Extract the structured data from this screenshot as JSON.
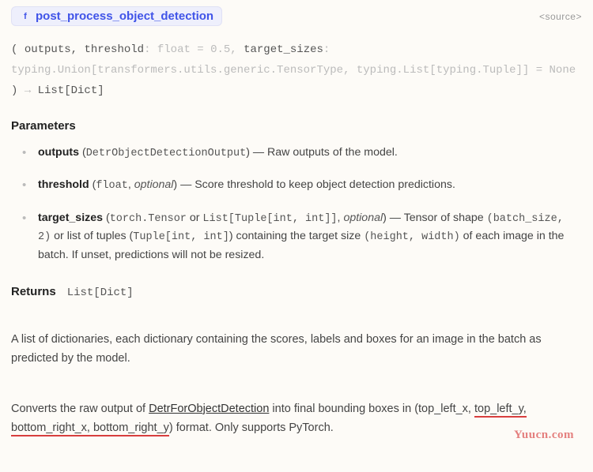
{
  "header": {
    "fn_icon_glyph": "f",
    "fn_name": "post_process_object_detection",
    "source_label": "<source>"
  },
  "signature": {
    "open": "( ",
    "p1": "outputs",
    "sep1": ", ",
    "p2": "threshold",
    "p2_type": ": float = 0.5, ",
    "p3": "target_sizes",
    "p3_type": ": typing.Union[transformers.utils.generic.TensorType, typing.List[typing.Tuple]] = None ",
    "close": ") ",
    "arrow": "→ ",
    "ret": "List[Dict]"
  },
  "params_title": "Parameters",
  "params": [
    {
      "name": "outputs",
      "type_open": " (",
      "type_code": "DetrObjectDetectionOutput",
      "type_close": ") — ",
      "desc": "Raw outputs of the model."
    },
    {
      "name": "threshold",
      "type_open": " (",
      "type_code": "float",
      "optional_sep": ", ",
      "optional": "optional",
      "type_close": ") — ",
      "desc": "Score threshold to keep object detection predictions."
    },
    {
      "name": "target_sizes",
      "type_open": " (",
      "type_code": "torch.Tensor",
      "or_text": " or ",
      "type_code2": "List[Tuple[int, int]]",
      "optional_sep": ", ",
      "optional": "optional",
      "type_close": ") — ",
      "desc_a": "Tensor of shape ",
      "code_a": "(batch_size, 2)",
      "desc_b": " or list of tuples (",
      "code_b": "Tuple[int, int]",
      "desc_c": ") containing the target size ",
      "code_c": "(height, width)",
      "desc_d": " of each image in the batch. If unset, predictions will not be resized."
    }
  ],
  "returns_label": "Returns",
  "returns_type": "List[Dict]",
  "body1": "A list of dictionaries, each dictionary containing the scores, labels and boxes for an image in the batch as predicted by the model.",
  "body2": {
    "a": "Converts the raw output of ",
    "link": "DetrForObjectDetection",
    "b": " into final bounding boxes in (top_left_x, ",
    "red1": "top_left_y,",
    "c": " ",
    "red2": "bottom_right_x, bottom_right_y",
    "d": ") format. Only supports PyTorch."
  },
  "watermark": "Yuucn.com"
}
